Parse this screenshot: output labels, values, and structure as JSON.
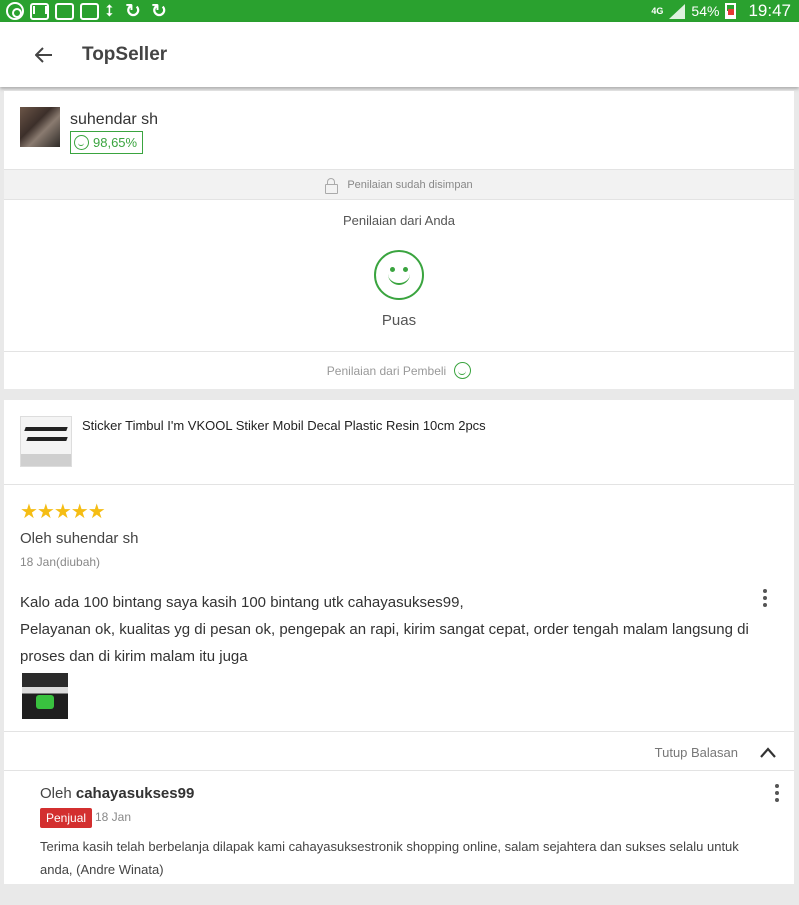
{
  "status_bar": {
    "network": "4G",
    "battery": "54%",
    "time": "19:47"
  },
  "app_bar": {
    "title": "TopSeller"
  },
  "seller": {
    "name": "suhendar sh",
    "rating": "98,65%"
  },
  "rating_saved_text": "Penilaian sudah disimpan",
  "your_rating": {
    "label": "Penilaian dari Anda",
    "result": "Puas"
  },
  "buyer_rating_label": "Penilaian dari Pembeli",
  "product": {
    "name": "Sticker Timbul I'm VKOOL Stiker Mobil Decal Plastic Resin 10cm 2pcs"
  },
  "review": {
    "stars": 5,
    "stars_text": "★★★★★",
    "author": "Oleh suhendar sh",
    "date": "18 Jan(diubah)",
    "text": "Kalo ada 100 bintang saya kasih 100 bintang utk cahayasukses99,\nPelayanan ok, kualitas yg di pesan ok, pengepak an rapi, kirim sangat cepat, order tengah malam langsung di proses dan di kirim malam itu juga"
  },
  "reply_toggle": "Tutup Balasan",
  "reply": {
    "by_prefix": "Oleh",
    "author": "cahayasukses99",
    "badge": "Penjual",
    "date": "18 Jan",
    "text": "Terima kasih telah berbelanja dilapak kami cahayasuksestronik shopping online, salam sejahtera dan sukses selalu untuk anda, (Andre Winata)"
  },
  "colors": {
    "status_bar": "#2aa12f",
    "accent_green": "#3aa43f",
    "star": "#f5bd14",
    "seller_badge": "#d32f2f"
  }
}
